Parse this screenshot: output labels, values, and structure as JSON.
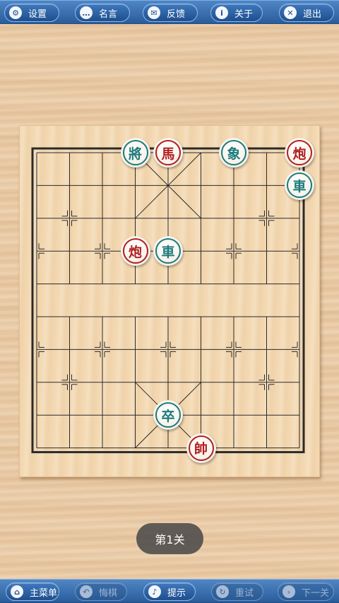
{
  "top_bar": {
    "buttons": [
      {
        "label": "设置",
        "icon": "gear-icon",
        "glyph": "⚙"
      },
      {
        "label": "名言",
        "icon": "speech-bubble-icon",
        "glyph": "…"
      },
      {
        "label": "反馈",
        "icon": "envelope-icon",
        "glyph": "✉"
      },
      {
        "label": "关于",
        "icon": "info-icon",
        "glyph": "i"
      },
      {
        "label": "退出",
        "icon": "close-icon",
        "glyph": "✕"
      }
    ]
  },
  "board": {
    "columns": 9,
    "rows": 10,
    "pieces": [
      {
        "char": "將",
        "side": "teal",
        "col": 3,
        "row": 0
      },
      {
        "char": "馬",
        "side": "red",
        "col": 4,
        "row": 0
      },
      {
        "char": "象",
        "side": "teal",
        "col": 6,
        "row": 0
      },
      {
        "char": "炮",
        "side": "red",
        "col": 8,
        "row": 0
      },
      {
        "char": "車",
        "side": "teal",
        "col": 8,
        "row": 1
      },
      {
        "char": "炮",
        "side": "red",
        "col": 3,
        "row": 3
      },
      {
        "char": "車",
        "side": "teal",
        "col": 4,
        "row": 3
      },
      {
        "char": "卒",
        "side": "teal",
        "col": 4,
        "row": 8
      },
      {
        "char": "帥",
        "side": "red",
        "col": 5,
        "row": 9
      }
    ]
  },
  "level_label": "第1关",
  "bottom_bar": {
    "buttons": [
      {
        "label": "主菜单",
        "icon": "home-icon",
        "glyph": "⌂",
        "enabled": true
      },
      {
        "label": "悔棋",
        "icon": "undo-icon",
        "glyph": "↶",
        "enabled": false
      },
      {
        "label": "提示",
        "icon": "bell-icon",
        "glyph": "♪",
        "enabled": true
      },
      {
        "label": "重试",
        "icon": "retry-icon",
        "glyph": "↻",
        "enabled": false
      },
      {
        "label": "下一关",
        "icon": "next-icon",
        "glyph": "›",
        "enabled": false
      }
    ]
  },
  "colors": {
    "red_piece": "#b21e1e",
    "teal_piece": "#1d7a7a",
    "toolbar": "#2a5c9a"
  }
}
